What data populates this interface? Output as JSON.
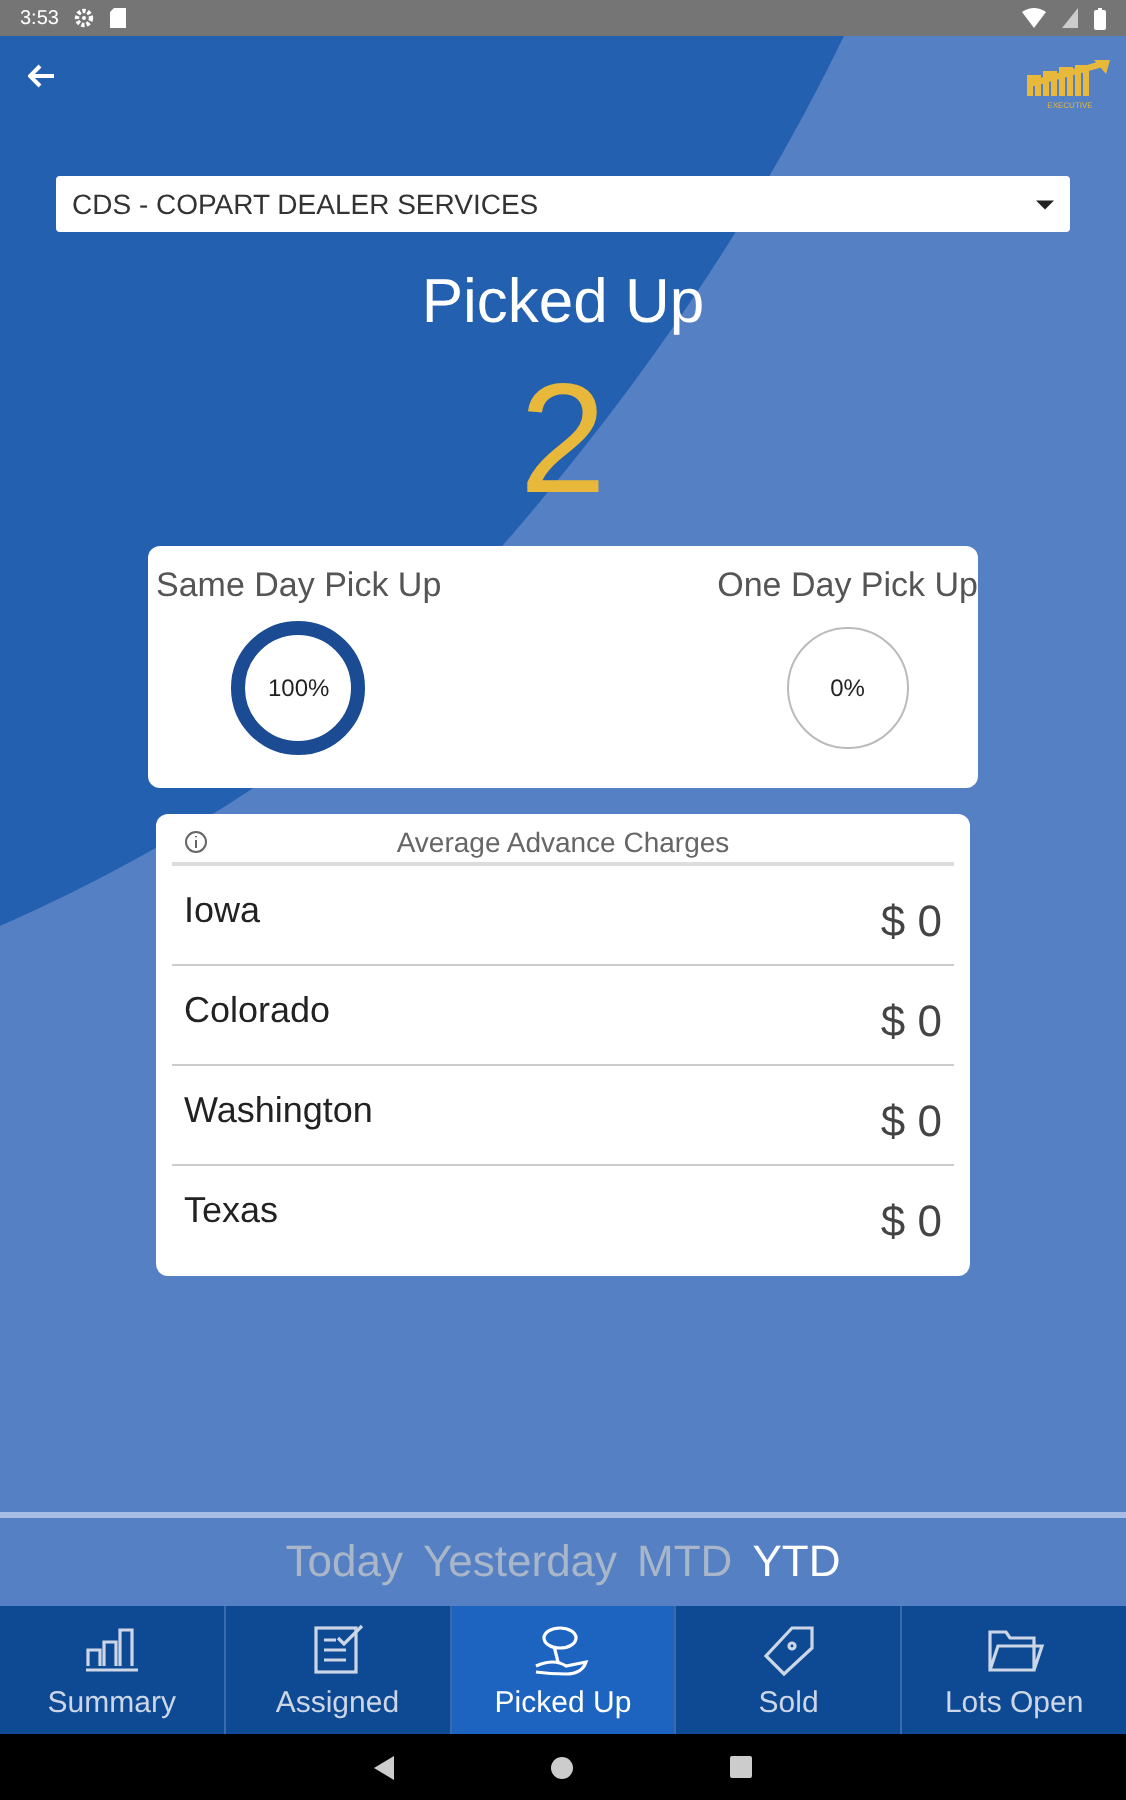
{
  "status_bar": {
    "time": "3:53"
  },
  "logo": {
    "caption": "EXECUTIVE"
  },
  "dealer_select": {
    "value": "CDS - COPART DEALER SERVICES"
  },
  "title": "Picked Up",
  "count": "2",
  "pickup_stats": [
    {
      "label": "Same Day Pick Up",
      "reading": "100%",
      "level": 1
    },
    {
      "label": "One Day Pick Up",
      "reading": "0%"
    }
  ],
  "charges": {
    "title": "Average Advance Charges",
    "rows": [
      {
        "state": "Iowa",
        "amount": "$ 0"
      },
      {
        "state": "Colorado",
        "amount": "$ 0"
      },
      {
        "state": "Washington",
        "amount": "$ 0"
      },
      {
        "state": "Texas",
        "amount": "$ 0"
      }
    ]
  },
  "periods": [
    {
      "label": "Today",
      "selected": false
    },
    {
      "label": "Yesterday",
      "selected": false
    },
    {
      "label": "MTD",
      "selected": false
    },
    {
      "label": "YTD",
      "selected": true
    }
  ],
  "tabs": [
    {
      "kind": "summary",
      "label": "Summary",
      "selected": false
    },
    {
      "kind": "assigned",
      "label": "Assigned",
      "selected": false
    },
    {
      "kind": "picked",
      "label": "Picked Up",
      "selected": true
    },
    {
      "kind": "sold",
      "label": "Sold",
      "selected": false
    },
    {
      "kind": "lots",
      "label": "Lots Open",
      "selected": false
    }
  ]
}
